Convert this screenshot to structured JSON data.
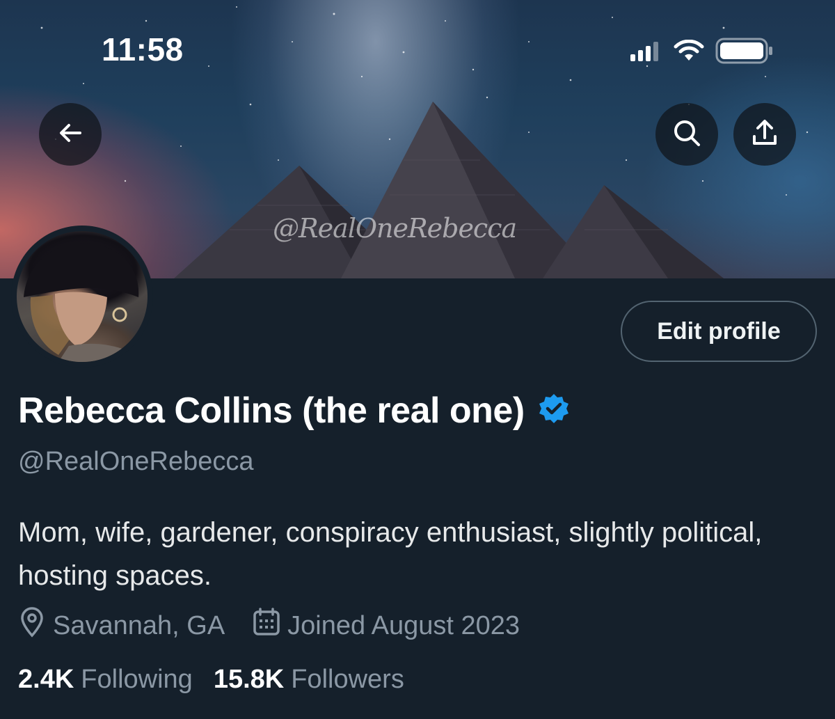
{
  "status_bar": {
    "time": "11:58"
  },
  "banner": {
    "watermark": "@RealOneRebecca"
  },
  "header": {
    "back_icon": "arrow-left-icon",
    "search_icon": "search-icon",
    "share_icon": "share-icon"
  },
  "profile": {
    "edit_button_label": "Edit profile",
    "display_name": "Rebecca Collins (the real one)",
    "verified_badge_color": "#1d9bf0",
    "handle": "@RealOneRebecca",
    "bio": "Mom, wife, gardener, conspiracy enthusiast, slightly political, hosting spaces.",
    "location": "Savannah, GA",
    "joined": "Joined August 2023",
    "following_count": "2.4K",
    "following_label": "Following",
    "followers_count": "15.8K",
    "followers_label": "Followers"
  },
  "colors": {
    "background": "#15202b",
    "secondary_text": "#8b98a5",
    "accent": "#1d9bf0"
  }
}
